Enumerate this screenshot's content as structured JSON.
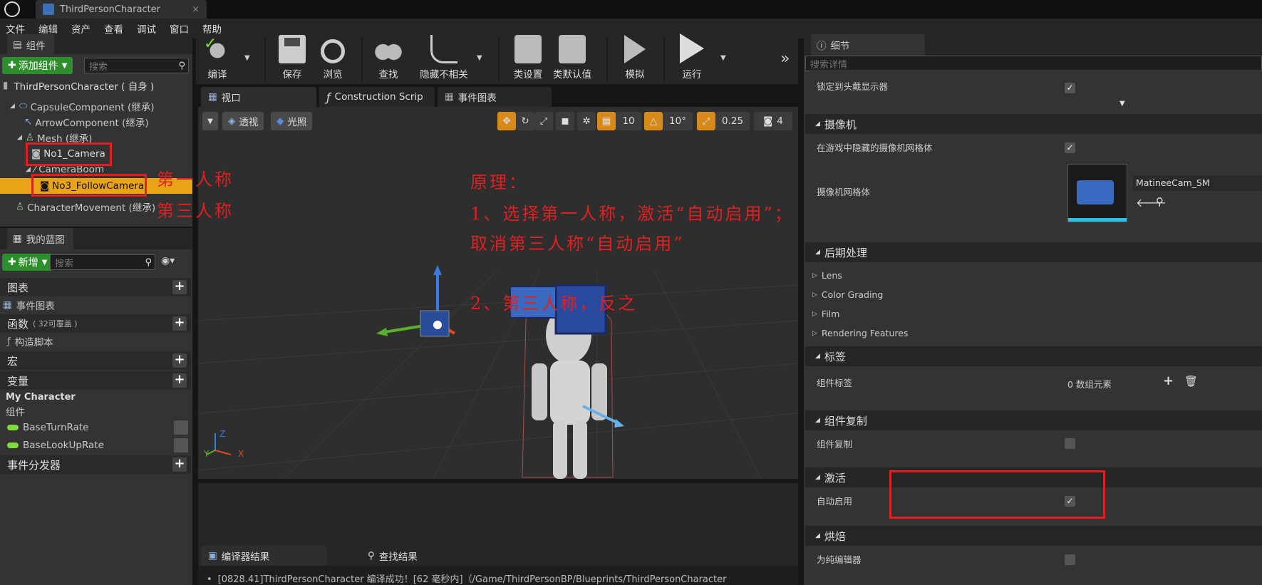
{
  "window": {
    "tab_title": "ThirdPersonCharacter",
    "close": "×"
  },
  "menu": [
    "文件",
    "编辑",
    "资产",
    "查看",
    "调试",
    "窗口",
    "帮助"
  ],
  "components": {
    "tab": "组件",
    "add_button": "添加组件",
    "search_placeholder": "搜索",
    "root": "ThirdPersonCharacter ( 自身 )",
    "items": [
      "CapsuleComponent (继承)",
      "ArrowComponent (继承)",
      "Mesh (继承)",
      "No1_Camera",
      "CameraBoom",
      "No3_FollowCamera",
      "CharacterMovement (继承)"
    ]
  },
  "myblueprint": {
    "tab": "我的蓝图",
    "new_button": "新增",
    "search_placeholder": "搜索",
    "sections": {
      "graph": "图表",
      "event_graph": "事件图表",
      "functions": "函数",
      "functions_note": "( 32可覆盖 )",
      "construction": "构造脚本",
      "macros": "宏",
      "variables": "变量",
      "my_character": "My Character",
      "components": "组件",
      "var1": "BaseTurnRate",
      "var2": "BaseLookUpRate",
      "dispatchers": "事件分发器"
    }
  },
  "toolbar": [
    "编译",
    "保存",
    "浏览",
    "查找",
    "隐藏不相关",
    "类设置",
    "类默认值",
    "模拟",
    "运行"
  ],
  "view_tabs": [
    "视口",
    "Construction Scrip",
    "事件图表"
  ],
  "viewport": {
    "perspective": "透视",
    "lit": "光照",
    "grid": "10",
    "angle": "10°",
    "scale": "0.25",
    "speed": "4"
  },
  "annotations": {
    "first": "第一人称",
    "third": "第三人称",
    "principle": "原理：",
    "line1": "1、选择第一人称，激活“自动启用”；",
    "line2": "取消第三人称“自动启用”",
    "line3": "2、第三人称，反之"
  },
  "details": {
    "tab": "细节",
    "search_placeholder": "搜索详情",
    "lock_hmd": "锁定到头戴显示器",
    "cat_camera": "摄像机",
    "hide_mesh": "在游戏中隐藏的摄像机网格体",
    "camera_mesh": "摄像机网格体",
    "mesh_name": "MatineeCam_SM",
    "cat_post": "后期处理",
    "post_items": [
      "Lens",
      "Color Grading",
      "Film",
      "Rendering Features"
    ],
    "cat_tags": "标签",
    "component_tags": "组件标签",
    "tags_value": "0 数组元素",
    "cat_replication": "组件复制",
    "replication": "组件复制",
    "cat_activation": "激活",
    "auto_activate": "自动启用",
    "cat_bake": "烘焙",
    "editor_only": "为纯编辑器"
  },
  "bottom": {
    "tabs": [
      "编译器结果",
      "查找结果"
    ],
    "log": "[0828.41]ThirdPersonCharacter 编译成功！[62 毫秒内]（/Game/ThirdPersonBP/Blueprints/ThirdPersonCharacter"
  },
  "colors": {
    "selected": "#e8a317",
    "accent_green": "#2c8f2c",
    "annotation_red": "#e02020"
  }
}
